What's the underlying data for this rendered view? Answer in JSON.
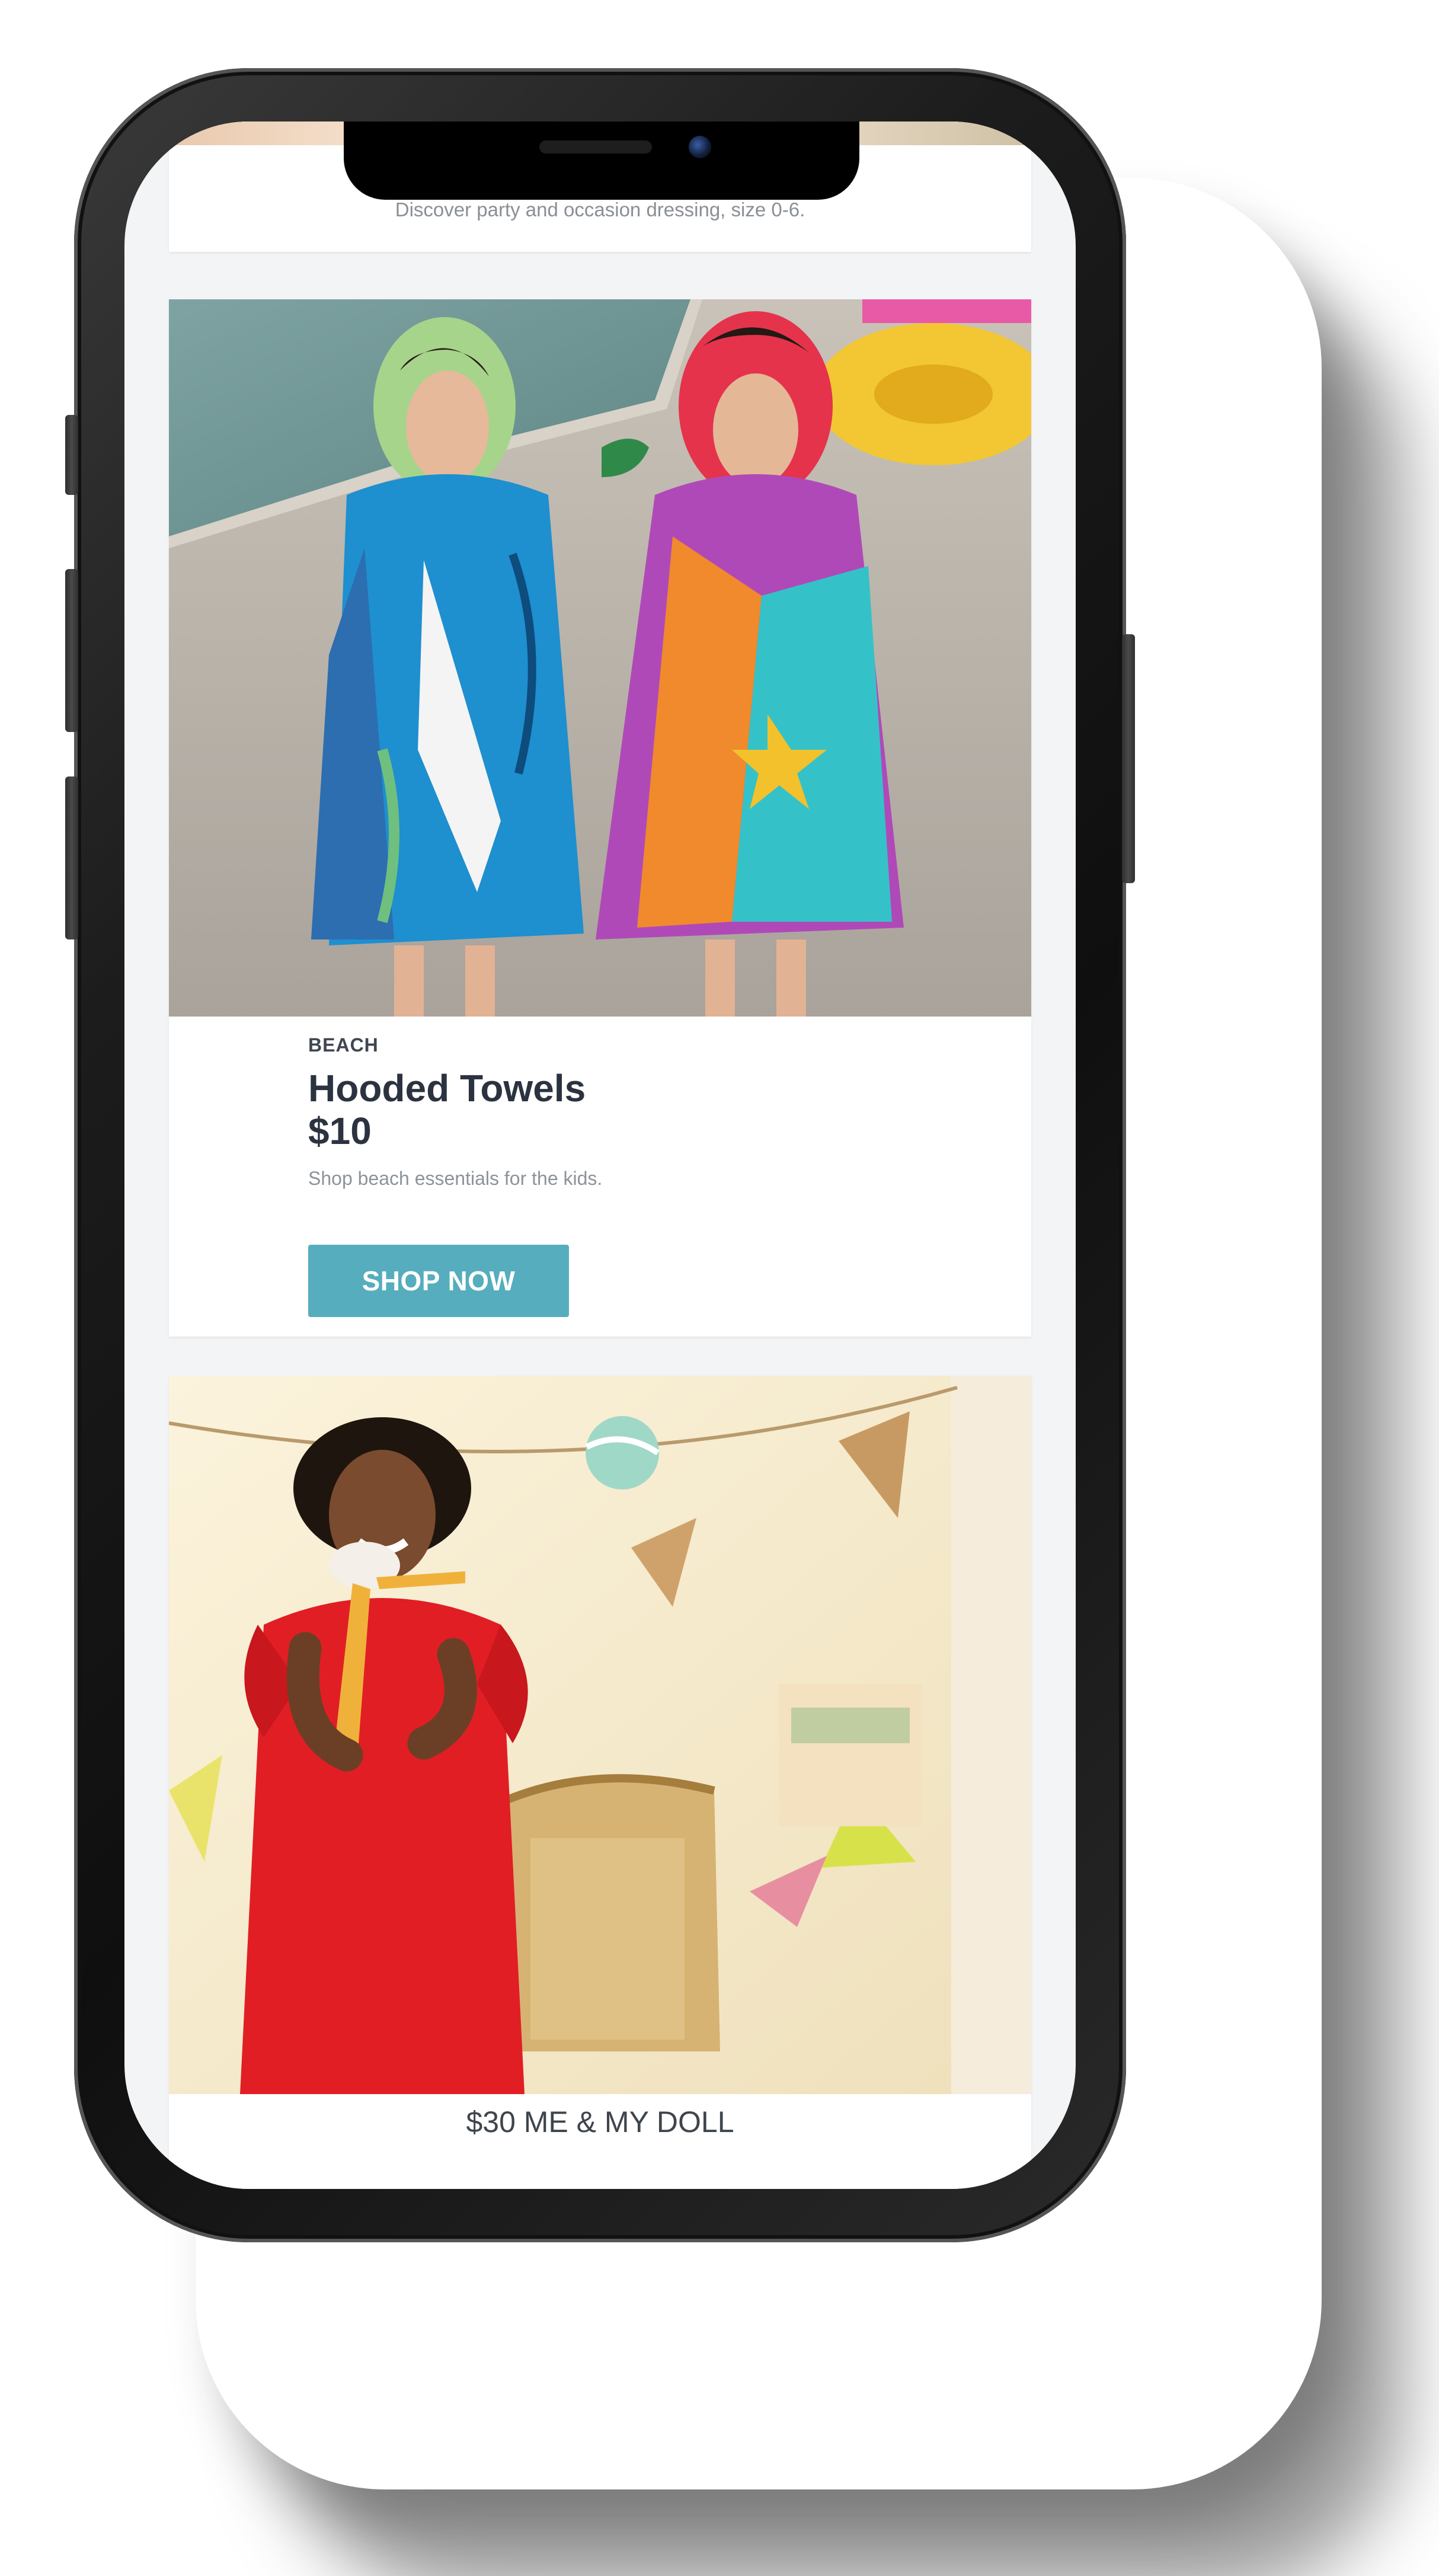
{
  "top_card": {
    "caption": "Discover party and occasion dressing, size 0-6."
  },
  "towels_card": {
    "image_alt": "Two children wearing hooded beach towels by a pool",
    "eyebrow": "BEACH",
    "title": "Hooded Towels",
    "price": "$10",
    "description": "Shop beach essentials for the kids.",
    "button_label": "SHOP NOW"
  },
  "doll_card": {
    "image_alt": "Smiling girl in a red dress holding a doll",
    "caption": "$30 ME & MY DOLL"
  },
  "colors": {
    "button": "#56adbd",
    "heading": "#2b3340",
    "muted_text": "#8d9399",
    "screen_background": "#f3f4f5"
  }
}
